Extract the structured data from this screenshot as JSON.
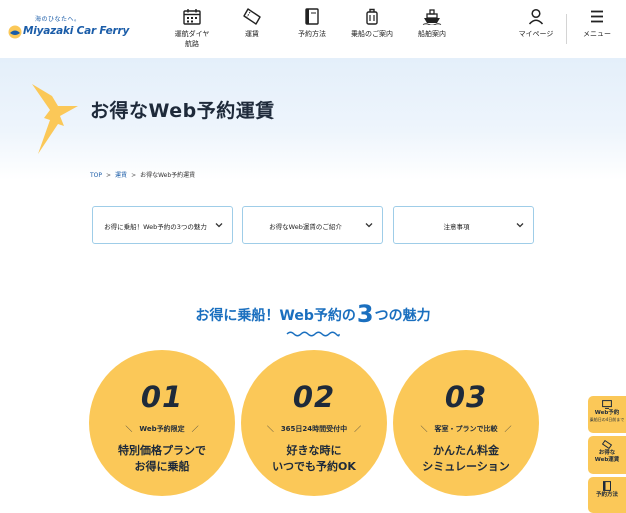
{
  "header": {
    "logo_tagline": "海のひなたへ。",
    "logo_name": "Miyazaki Car Ferry",
    "nav": [
      {
        "label": "運航ダイヤ\n航路",
        "icon": "calendar-icon"
      },
      {
        "label": "運賃",
        "icon": "ticket-icon"
      },
      {
        "label": "予約方法",
        "icon": "book-icon"
      },
      {
        "label": "乗船のご案内",
        "icon": "luggage-icon"
      },
      {
        "label": "船舶案内",
        "icon": "ship-icon"
      }
    ],
    "mypage_label": "マイページ",
    "menu_label": "メニュー"
  },
  "hero": {
    "title": "お得なWeb予約運賃"
  },
  "breadcrumb": {
    "items": [
      "TOP",
      "運賃",
      "お得なWeb予約運賃"
    ]
  },
  "anchors": [
    {
      "label": "お得に乗船！Web予約の3つの魅力"
    },
    {
      "label": "お得なWeb運賃のご紹介"
    },
    {
      "label": "注意事項"
    }
  ],
  "section": {
    "heading_before": "お得に乗船！Web予約の",
    "heading_number": "3",
    "heading_after": "つの魅力"
  },
  "features": [
    {
      "number": "01",
      "tag": "Web予約限定",
      "desc": "特別価格プランで\nお得に乗船"
    },
    {
      "number": "02",
      "tag": "365日24時間受付中",
      "desc": "好きな時に\nいつでも予約OK"
    },
    {
      "number": "03",
      "tag": "客室・プランで比較",
      "desc": "かんたん料金\nシミュレーション"
    }
  ],
  "side_tabs": [
    {
      "title": "Web予約",
      "sub": "乗船日の4日前まで",
      "icon": "monitor-icon"
    },
    {
      "title": "お得な\nWeb運賃",
      "icon": "ticket-icon"
    },
    {
      "title": "予約方法",
      "icon": "book-icon"
    }
  ],
  "colors": {
    "brand_blue": "#1a5ca8",
    "heading_blue": "#1a6fbf",
    "accent_yellow": "#fbc858",
    "anchor_border": "#9fcde8",
    "text_dark": "#1e2a3a"
  }
}
